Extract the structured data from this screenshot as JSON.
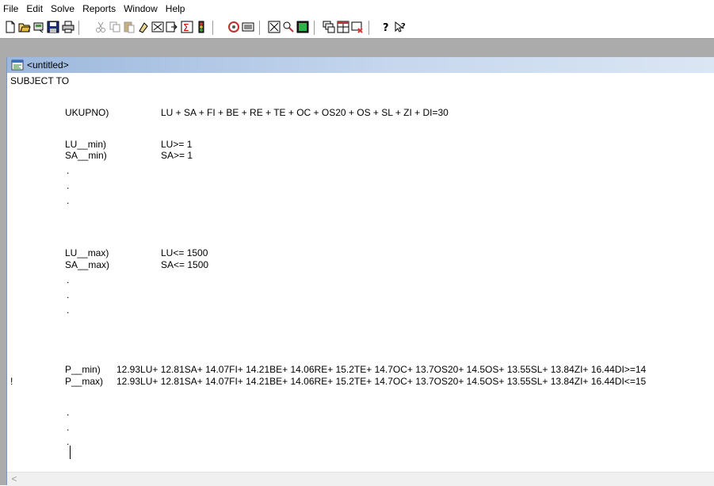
{
  "menu": {
    "items": [
      "File",
      "Edit",
      "Solve",
      "Reports",
      "Window",
      "Help"
    ]
  },
  "toolbar": {
    "buttons": [
      "new-icon",
      "open-icon",
      "open-file-icon",
      "save-icon",
      "print-icon",
      "cut-icon",
      "copy-icon",
      "paste-icon",
      "find-icon",
      "clear-icon",
      "send-to-back-icon",
      "solve-sum-icon",
      "go-icon",
      "options-icon",
      "window-icon",
      "matrix-picture-icon",
      "look-icon",
      "compile-icon",
      "cascade-icon",
      "tile-icon",
      "close-all-icon",
      "help-icon",
      "context-help-icon"
    ]
  },
  "document": {
    "title": "<untitled>"
  },
  "editor": {
    "lines": {
      "l1": "SUBJECT TO",
      "ukupno_label": "UKUPNO)",
      "ukupno_expr": "LU + SA + FI + BE + RE + TE + OC + OS20 + OS + SL + ZI + DI=30",
      "lu_min_label": "LU__min)",
      "lu_min_expr": "LU>= 1",
      "sa_min_label": "SA__min)",
      "sa_min_expr": "SA>= 1",
      "dot": ".",
      "lu_max_label": "LU__max)",
      "lu_max_expr": "LU<= 1500",
      "sa_max_label": "SA__max)",
      "sa_max_expr": "SA<= 1500",
      "p_min_label": "P__min)",
      "p_min_expr": "12.93LU+ 12.81SA+ 14.07FI+ 14.21BE+ 14.06RE+ 15.2TE+ 14.7OC+ 13.7OS20+ 14.5OS+ 13.55SL+ 13.84ZI+ 16.44DI>=14",
      "bang": "!",
      "p_max_label": "P__max)",
      "p_max_expr": "12.93LU+ 12.81SA+ 14.07FI+ 14.21BE+ 14.06RE+ 15.2TE+ 14.7OC+ 13.7OS20+ 14.5OS+ 13.55SL+ 13.84ZI+ 16.44DI<=15"
    }
  },
  "scrollbar": {
    "left_arrow": "<"
  }
}
